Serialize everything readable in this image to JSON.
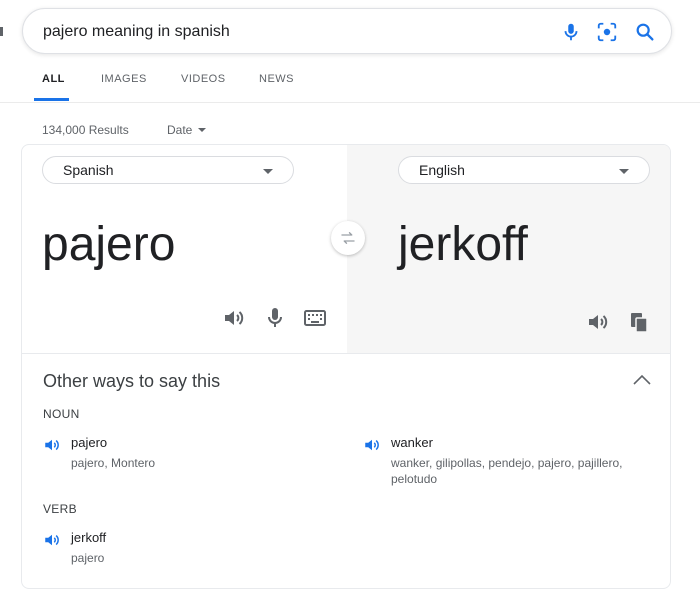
{
  "search": {
    "query": "pajero meaning in spanish",
    "icons": [
      "mic-icon",
      "lens-icon",
      "search-icon"
    ],
    "accent": "#1a73e8"
  },
  "tabs": [
    {
      "label": "ALL",
      "active": true
    },
    {
      "label": "IMAGES",
      "active": false
    },
    {
      "label": "VIDEOS",
      "active": false
    },
    {
      "label": "NEWS",
      "active": false
    }
  ],
  "results": {
    "count": "134,000 Results",
    "date_filter": "Date"
  },
  "translator": {
    "source_lang": "Spanish",
    "target_lang": "English",
    "source_text": "pajero",
    "target_text": "jerkoff",
    "source_tools": [
      "speaker-icon",
      "mic-icon",
      "keyboard-icon"
    ],
    "target_tools": [
      "speaker-icon",
      "copy-icon"
    ],
    "speaker_color": "#1a73e8"
  },
  "other_ways": {
    "title": "Other ways to say this",
    "sections": [
      {
        "pos": "NOUN",
        "entries": [
          {
            "word": "pajero",
            "synonyms": "pajero, Montero"
          },
          {
            "word": "wanker",
            "synonyms": "wanker, gilipollas, pendejo, pajero, pajillero, pelotudo"
          }
        ]
      },
      {
        "pos": "VERB",
        "entries": [
          {
            "word": "jerkoff",
            "synonyms": "pajero"
          }
        ]
      }
    ]
  }
}
